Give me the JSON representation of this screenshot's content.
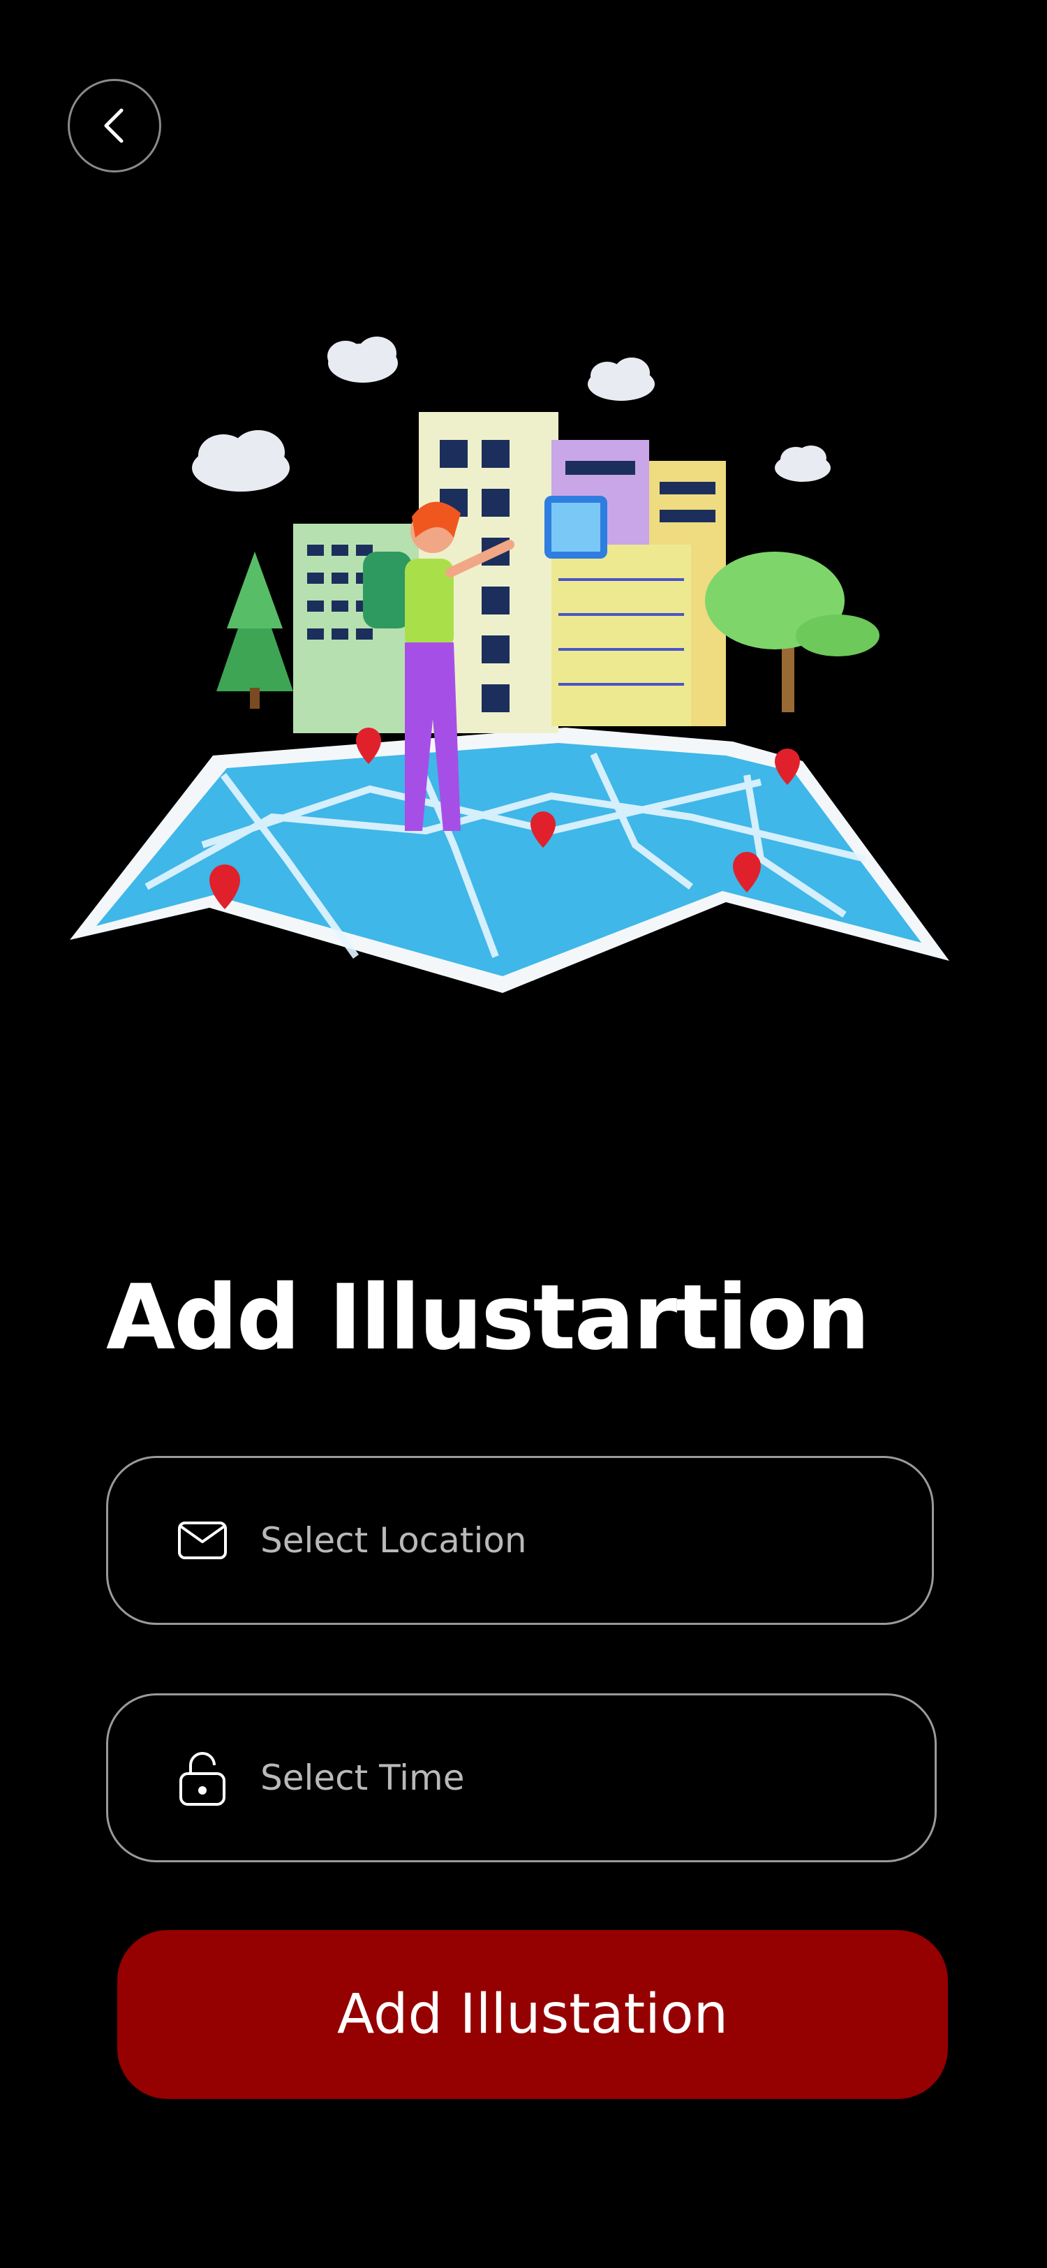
{
  "header": {
    "back_icon": "chevron-left-icon"
  },
  "hero": {
    "illustration": "map-city-traveler-illustration"
  },
  "title": "Add Illustartion",
  "form": {
    "location": {
      "placeholder": "Select Location",
      "value": "",
      "icon": "envelope-icon"
    },
    "time": {
      "placeholder": "Select Time",
      "value": "",
      "icon": "lock-icon"
    }
  },
  "cta": {
    "label": "Add Illustation",
    "color": "#950000"
  }
}
